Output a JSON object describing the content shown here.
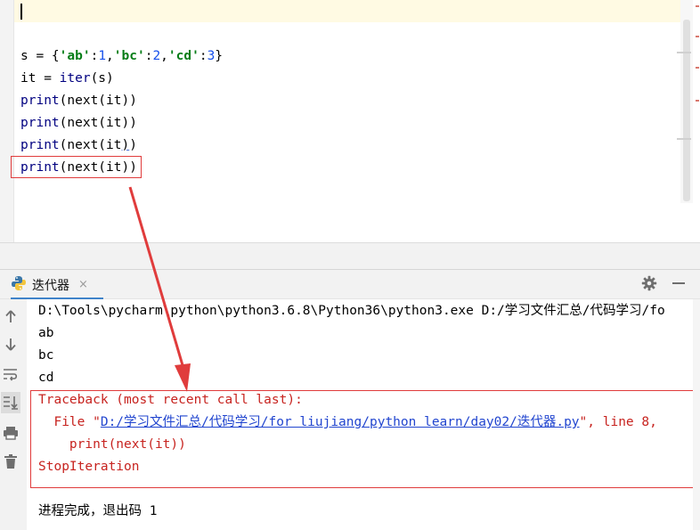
{
  "editor": {
    "lines": {
      "l1": {
        "var": "s",
        "op": " = {",
        "k1": "'ab'",
        "c1": ":",
        "v1": "1",
        "sep1": ",",
        "k2": "'bc'",
        "c2": ":",
        "v2": "2",
        "sep2": ",",
        "k3": "'cd'",
        "c3": ":",
        "v3": "3",
        "close": "}"
      },
      "l2": {
        "text": "it = ",
        "fn": "iter",
        "rest": "(s)"
      },
      "l3": {
        "fn": "print",
        "rest": "(next(it))"
      },
      "l4": {
        "fn": "print",
        "rest": "(next(it))"
      },
      "l5": {
        "fn": "print",
        "rest_a": "(next(it",
        "rest_b": ")",
        "rest_c": ")"
      },
      "l6": {
        "fn": "print",
        "rest": "(next(it))"
      }
    }
  },
  "run_panel": {
    "tab_label": "迭代器",
    "tab_close": "×",
    "icons": [
      "python-file-icon",
      "gear-icon",
      "minimize-icon",
      "scroll-up-icon",
      "scroll-down-icon",
      "soft-wrap-icon",
      "scroll-to-end-icon",
      "print-icon",
      "trash-icon"
    ],
    "output": {
      "command": "D:\\Tools\\pycharm\\python\\python3.6.8\\Python36\\python3.exe D:/学习文件汇总/代码学习/fo",
      "out1": "ab",
      "out2": "bc",
      "out3": "cd",
      "tb_header": "Traceback (most recent call last):",
      "tb_file_prefix": "  File \"",
      "tb_file_link": "D:/学习文件汇总/代码学习/for liujiang/python learn/day02/迭代器.py",
      "tb_file_suffix": "\", line 8,",
      "tb_code": "    print(next(it))",
      "tb_error": "StopIteration",
      "exit_msg": "进程完成，退出码 1"
    }
  },
  "colors": {
    "annotation_red": "#e03c3c",
    "string_green": "#067d17",
    "number_blue": "#1750eb",
    "error_red": "#c7231f",
    "link_blue": "#2145cf",
    "tab_accent": "#4083c9"
  }
}
